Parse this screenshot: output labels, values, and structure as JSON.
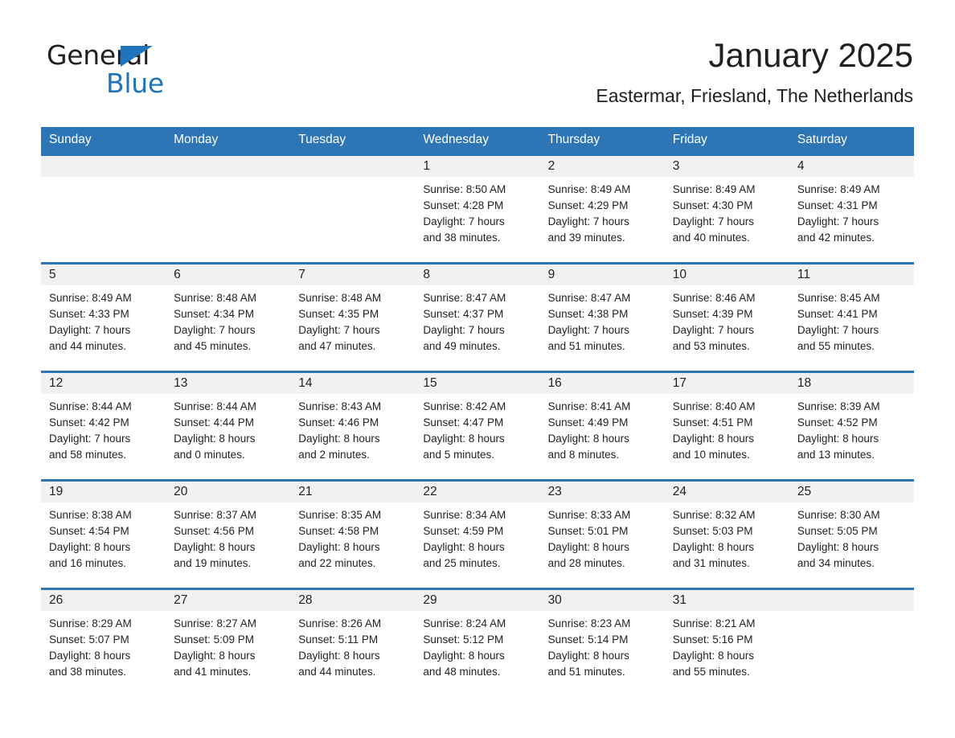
{
  "brand": {
    "name_part1": "General",
    "name_part2": "Blue",
    "triangle_color": "#1f74bb",
    "logo_icon": "triangle-icon"
  },
  "header": {
    "title": "January 2025",
    "subtitle": "Eastermar, Friesland, The Netherlands"
  },
  "theme": {
    "header_blue": "#2e75b6",
    "row_border_blue": "#2e75b6",
    "daynum_band": "#f1f1f1",
    "text": "#231f20"
  },
  "calendar": {
    "weekday_headers": [
      "Sunday",
      "Monday",
      "Tuesday",
      "Wednesday",
      "Thursday",
      "Friday",
      "Saturday"
    ],
    "weeks": [
      [
        {
          "day": "",
          "sunrise": "",
          "sunset": "",
          "daylight_line1": "",
          "daylight_line2": "",
          "empty": true
        },
        {
          "day": "",
          "sunrise": "",
          "sunset": "",
          "daylight_line1": "",
          "daylight_line2": "",
          "empty": true
        },
        {
          "day": "",
          "sunrise": "",
          "sunset": "",
          "daylight_line1": "",
          "daylight_line2": "",
          "empty": true
        },
        {
          "day": "1",
          "sunrise": "Sunrise: 8:50 AM",
          "sunset": "Sunset: 4:28 PM",
          "daylight_line1": "Daylight: 7 hours",
          "daylight_line2": "and 38 minutes."
        },
        {
          "day": "2",
          "sunrise": "Sunrise: 8:49 AM",
          "sunset": "Sunset: 4:29 PM",
          "daylight_line1": "Daylight: 7 hours",
          "daylight_line2": "and 39 minutes."
        },
        {
          "day": "3",
          "sunrise": "Sunrise: 8:49 AM",
          "sunset": "Sunset: 4:30 PM",
          "daylight_line1": "Daylight: 7 hours",
          "daylight_line2": "and 40 minutes."
        },
        {
          "day": "4",
          "sunrise": "Sunrise: 8:49 AM",
          "sunset": "Sunset: 4:31 PM",
          "daylight_line1": "Daylight: 7 hours",
          "daylight_line2": "and 42 minutes."
        }
      ],
      [
        {
          "day": "5",
          "sunrise": "Sunrise: 8:49 AM",
          "sunset": "Sunset: 4:33 PM",
          "daylight_line1": "Daylight: 7 hours",
          "daylight_line2": "and 44 minutes."
        },
        {
          "day": "6",
          "sunrise": "Sunrise: 8:48 AM",
          "sunset": "Sunset: 4:34 PM",
          "daylight_line1": "Daylight: 7 hours",
          "daylight_line2": "and 45 minutes."
        },
        {
          "day": "7",
          "sunrise": "Sunrise: 8:48 AM",
          "sunset": "Sunset: 4:35 PM",
          "daylight_line1": "Daylight: 7 hours",
          "daylight_line2": "and 47 minutes."
        },
        {
          "day": "8",
          "sunrise": "Sunrise: 8:47 AM",
          "sunset": "Sunset: 4:37 PM",
          "daylight_line1": "Daylight: 7 hours",
          "daylight_line2": "and 49 minutes."
        },
        {
          "day": "9",
          "sunrise": "Sunrise: 8:47 AM",
          "sunset": "Sunset: 4:38 PM",
          "daylight_line1": "Daylight: 7 hours",
          "daylight_line2": "and 51 minutes."
        },
        {
          "day": "10",
          "sunrise": "Sunrise: 8:46 AM",
          "sunset": "Sunset: 4:39 PM",
          "daylight_line1": "Daylight: 7 hours",
          "daylight_line2": "and 53 minutes."
        },
        {
          "day": "11",
          "sunrise": "Sunrise: 8:45 AM",
          "sunset": "Sunset: 4:41 PM",
          "daylight_line1": "Daylight: 7 hours",
          "daylight_line2": "and 55 minutes."
        }
      ],
      [
        {
          "day": "12",
          "sunrise": "Sunrise: 8:44 AM",
          "sunset": "Sunset: 4:42 PM",
          "daylight_line1": "Daylight: 7 hours",
          "daylight_line2": "and 58 minutes."
        },
        {
          "day": "13",
          "sunrise": "Sunrise: 8:44 AM",
          "sunset": "Sunset: 4:44 PM",
          "daylight_line1": "Daylight: 8 hours",
          "daylight_line2": "and 0 minutes."
        },
        {
          "day": "14",
          "sunrise": "Sunrise: 8:43 AM",
          "sunset": "Sunset: 4:46 PM",
          "daylight_line1": "Daylight: 8 hours",
          "daylight_line2": "and 2 minutes."
        },
        {
          "day": "15",
          "sunrise": "Sunrise: 8:42 AM",
          "sunset": "Sunset: 4:47 PM",
          "daylight_line1": "Daylight: 8 hours",
          "daylight_line2": "and 5 minutes."
        },
        {
          "day": "16",
          "sunrise": "Sunrise: 8:41 AM",
          "sunset": "Sunset: 4:49 PM",
          "daylight_line1": "Daylight: 8 hours",
          "daylight_line2": "and 8 minutes."
        },
        {
          "day": "17",
          "sunrise": "Sunrise: 8:40 AM",
          "sunset": "Sunset: 4:51 PM",
          "daylight_line1": "Daylight: 8 hours",
          "daylight_line2": "and 10 minutes."
        },
        {
          "day": "18",
          "sunrise": "Sunrise: 8:39 AM",
          "sunset": "Sunset: 4:52 PM",
          "daylight_line1": "Daylight: 8 hours",
          "daylight_line2": "and 13 minutes."
        }
      ],
      [
        {
          "day": "19",
          "sunrise": "Sunrise: 8:38 AM",
          "sunset": "Sunset: 4:54 PM",
          "daylight_line1": "Daylight: 8 hours",
          "daylight_line2": "and 16 minutes."
        },
        {
          "day": "20",
          "sunrise": "Sunrise: 8:37 AM",
          "sunset": "Sunset: 4:56 PM",
          "daylight_line1": "Daylight: 8 hours",
          "daylight_line2": "and 19 minutes."
        },
        {
          "day": "21",
          "sunrise": "Sunrise: 8:35 AM",
          "sunset": "Sunset: 4:58 PM",
          "daylight_line1": "Daylight: 8 hours",
          "daylight_line2": "and 22 minutes."
        },
        {
          "day": "22",
          "sunrise": "Sunrise: 8:34 AM",
          "sunset": "Sunset: 4:59 PM",
          "daylight_line1": "Daylight: 8 hours",
          "daylight_line2": "and 25 minutes."
        },
        {
          "day": "23",
          "sunrise": "Sunrise: 8:33 AM",
          "sunset": "Sunset: 5:01 PM",
          "daylight_line1": "Daylight: 8 hours",
          "daylight_line2": "and 28 minutes."
        },
        {
          "day": "24",
          "sunrise": "Sunrise: 8:32 AM",
          "sunset": "Sunset: 5:03 PM",
          "daylight_line1": "Daylight: 8 hours",
          "daylight_line2": "and 31 minutes."
        },
        {
          "day": "25",
          "sunrise": "Sunrise: 8:30 AM",
          "sunset": "Sunset: 5:05 PM",
          "daylight_line1": "Daylight: 8 hours",
          "daylight_line2": "and 34 minutes."
        }
      ],
      [
        {
          "day": "26",
          "sunrise": "Sunrise: 8:29 AM",
          "sunset": "Sunset: 5:07 PM",
          "daylight_line1": "Daylight: 8 hours",
          "daylight_line2": "and 38 minutes."
        },
        {
          "day": "27",
          "sunrise": "Sunrise: 8:27 AM",
          "sunset": "Sunset: 5:09 PM",
          "daylight_line1": "Daylight: 8 hours",
          "daylight_line2": "and 41 minutes."
        },
        {
          "day": "28",
          "sunrise": "Sunrise: 8:26 AM",
          "sunset": "Sunset: 5:11 PM",
          "daylight_line1": "Daylight: 8 hours",
          "daylight_line2": "and 44 minutes."
        },
        {
          "day": "29",
          "sunrise": "Sunrise: 8:24 AM",
          "sunset": "Sunset: 5:12 PM",
          "daylight_line1": "Daylight: 8 hours",
          "daylight_line2": "and 48 minutes."
        },
        {
          "day": "30",
          "sunrise": "Sunrise: 8:23 AM",
          "sunset": "Sunset: 5:14 PM",
          "daylight_line1": "Daylight: 8 hours",
          "daylight_line2": "and 51 minutes."
        },
        {
          "day": "31",
          "sunrise": "Sunrise: 8:21 AM",
          "sunset": "Sunset: 5:16 PM",
          "daylight_line1": "Daylight: 8 hours",
          "daylight_line2": "and 55 minutes."
        },
        {
          "day": "",
          "sunrise": "",
          "sunset": "",
          "daylight_line1": "",
          "daylight_line2": "",
          "empty": true
        }
      ]
    ]
  }
}
